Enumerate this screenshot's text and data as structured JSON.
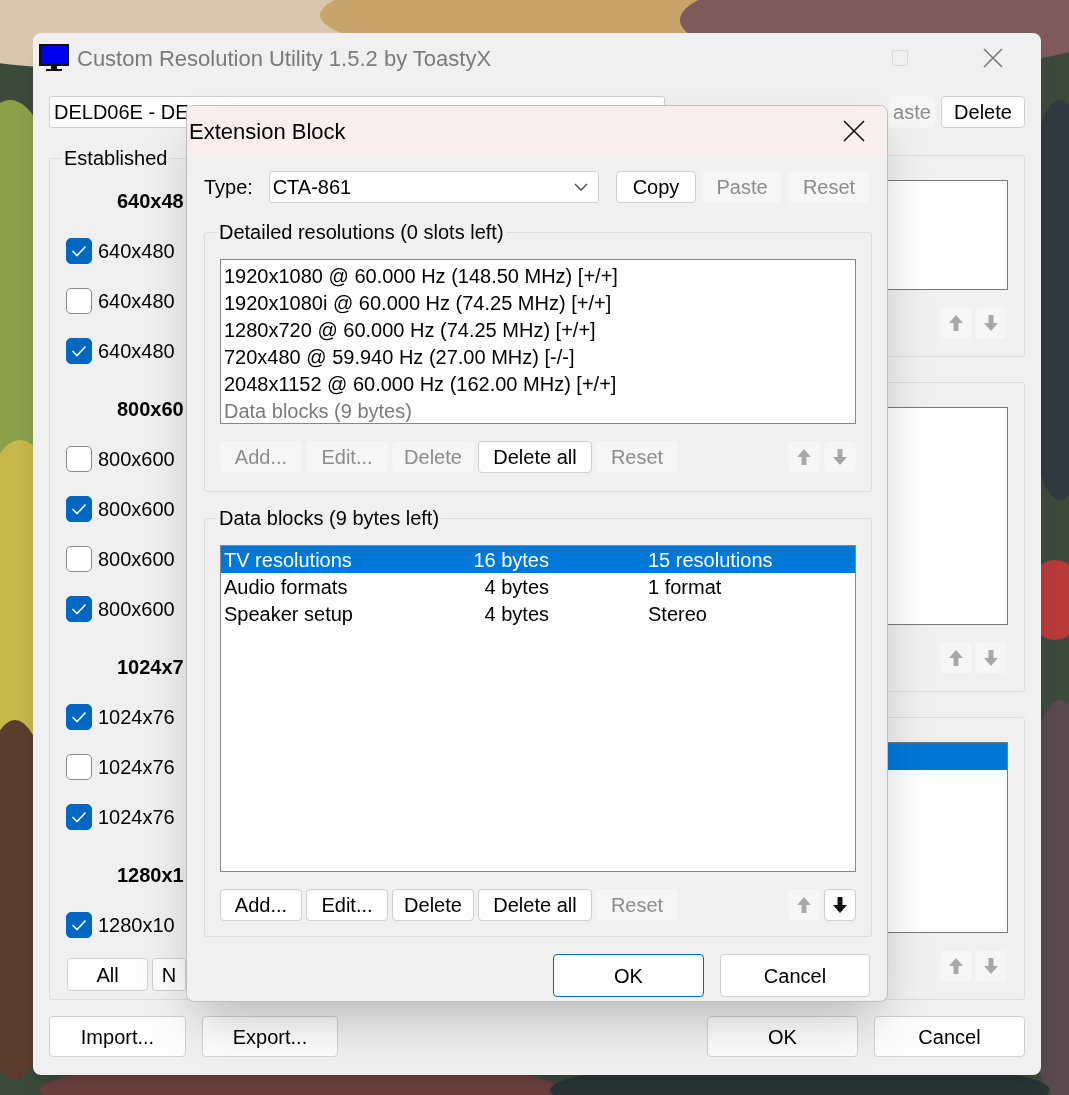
{
  "main_window": {
    "title": "Custom Resolution Utility 1.5.2 by ToastyX"
  },
  "display_select": {
    "value": "DELD06E - DE"
  },
  "top_buttons": [
    {
      "label": "aste",
      "disabled": true
    },
    {
      "label": "Delete",
      "disabled": false
    }
  ],
  "established": {
    "legend": "Established",
    "sections": [
      {
        "header": "640x48",
        "items": [
          {
            "label": "640x480",
            "checked": true
          },
          {
            "label": "640x480",
            "checked": false
          },
          {
            "label": "640x480",
            "checked": true
          }
        ]
      },
      {
        "header": "800x60",
        "items": [
          {
            "label": "800x600",
            "checked": false
          },
          {
            "label": "800x600",
            "checked": true
          },
          {
            "label": "800x600",
            "checked": false
          },
          {
            "label": "800x600",
            "checked": true
          }
        ]
      },
      {
        "header": "1024x7",
        "items": [
          {
            "label": "1024x76",
            "checked": true
          },
          {
            "label": "1024x76",
            "checked": false
          },
          {
            "label": "1024x76",
            "checked": true
          }
        ]
      },
      {
        "header": "1280x1",
        "items": [
          {
            "label": "1280x10",
            "checked": true
          }
        ]
      }
    ],
    "buttons": [
      {
        "label": "All"
      },
      {
        "label": "N"
      }
    ]
  },
  "side_lists": [
    {
      "has_selection": false,
      "up_disabled": true,
      "down_disabled": true
    },
    {
      "has_selection": false,
      "up_disabled": true,
      "down_disabled": true
    },
    {
      "has_selection": true,
      "up_disabled": true,
      "down_disabled": true
    }
  ],
  "bottom_buttons": [
    {
      "label": "Import..."
    },
    {
      "label": "Export..."
    },
    {
      "label": "OK"
    },
    {
      "label": "Cancel"
    }
  ],
  "dialog": {
    "title": "Extension Block",
    "type_label": "Type:",
    "type_value": "CTA-861",
    "type_buttons": [
      {
        "label": "Copy",
        "disabled": false
      },
      {
        "label": "Paste",
        "disabled": true
      },
      {
        "label": "Reset",
        "disabled": true
      }
    ],
    "detailed": {
      "legend": "Detailed resolutions (0 slots left)",
      "items": [
        {
          "kind": "timing",
          "text": "1920x1080 @ 60.000 Hz (148.50 MHz) [+/+]"
        },
        {
          "kind": "timing",
          "text": "1920x1080i @ 60.000 Hz (74.25 MHz) [+/+]"
        },
        {
          "kind": "timing",
          "text": "1280x720 @ 60.000 Hz (74.25 MHz) [+/+]"
        },
        {
          "kind": "timing",
          "text": "720x480 @ 59.940 Hz (27.00 MHz) [-/-]"
        },
        {
          "kind": "timing",
          "text": "2048x1152 @ 60.000 Hz (162.00 MHz) [+/+]"
        },
        {
          "kind": "footer",
          "text": "Data blocks (9 bytes)"
        }
      ],
      "buttons": [
        {
          "label": "Add...",
          "disabled": true
        },
        {
          "label": "Edit...",
          "disabled": true
        },
        {
          "label": "Delete",
          "disabled": true
        },
        {
          "label": "Delete all",
          "disabled": false
        },
        {
          "label": "Reset",
          "disabled": true
        }
      ],
      "up_disabled": true,
      "down_disabled": true
    },
    "data_blocks": {
      "legend": "Data blocks (9 bytes left)",
      "rows": [
        {
          "name": "TV resolutions",
          "size": "16 bytes",
          "info": "15 resolutions",
          "selected": true
        },
        {
          "name": "Audio formats",
          "size": "4 bytes",
          "info": "1 format",
          "selected": false
        },
        {
          "name": "Speaker setup",
          "size": "4 bytes",
          "info": "Stereo",
          "selected": false
        }
      ],
      "buttons": [
        {
          "label": "Add...",
          "disabled": false
        },
        {
          "label": "Edit...",
          "disabled": false
        },
        {
          "label": "Delete",
          "disabled": false
        },
        {
          "label": "Delete all",
          "disabled": false
        },
        {
          "label": "Reset",
          "disabled": true
        }
      ],
      "up_disabled": true,
      "down_disabled": false
    },
    "ok": "OK",
    "cancel": "Cancel"
  }
}
